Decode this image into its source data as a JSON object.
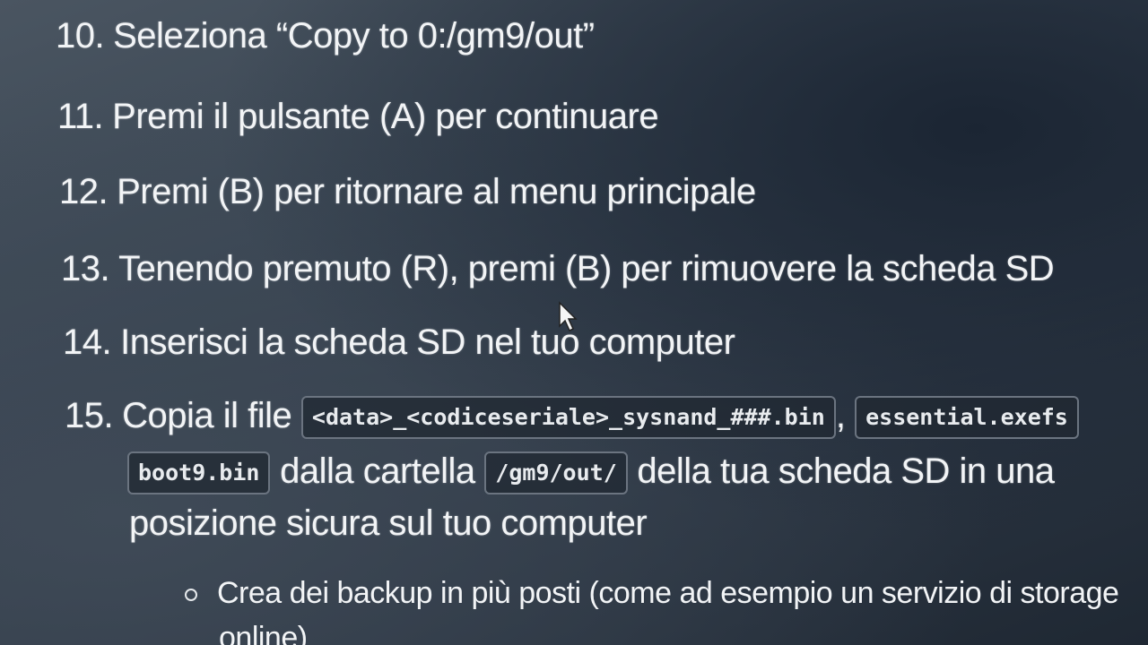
{
  "steps": [
    {
      "num": "10.",
      "text": "Seleziona “Copy to 0:/gm9/out”"
    },
    {
      "num": "11.",
      "text": "Premi il pulsante (A) per continuare"
    },
    {
      "num": "12.",
      "text": "Premi (B) per ritornare al menu principale"
    },
    {
      "num": "13.",
      "text": "Tenendo premuto (R), premi (B) per rimuovere la scheda SD"
    },
    {
      "num": "14.",
      "text": "Inserisci la scheda SD nel tuo computer"
    }
  ],
  "step15": {
    "num": "15.",
    "prefix": "Copia il file",
    "code_1": "<data>_<codiceseriale>_sysnand_###.bin",
    "separator": ",",
    "code_2": "essential.exefs",
    "code_3": "boot9.bin",
    "middle": "dalla cartella",
    "code_4": "/gm9/out/",
    "suffix": "della tua scheda SD in una",
    "line3": "posizione sicura sul tuo computer"
  },
  "sub_bullet": {
    "line1": "Crea dei backup in più posti (come ad esempio un servizio di storage",
    "line2": "online)"
  },
  "colors": {
    "background": "#3a4653",
    "text": "#f2f4f6",
    "code_border": "#6b7480"
  },
  "icons": [
    "mouse-cursor-icon",
    "hollow-bullet-icon"
  ]
}
